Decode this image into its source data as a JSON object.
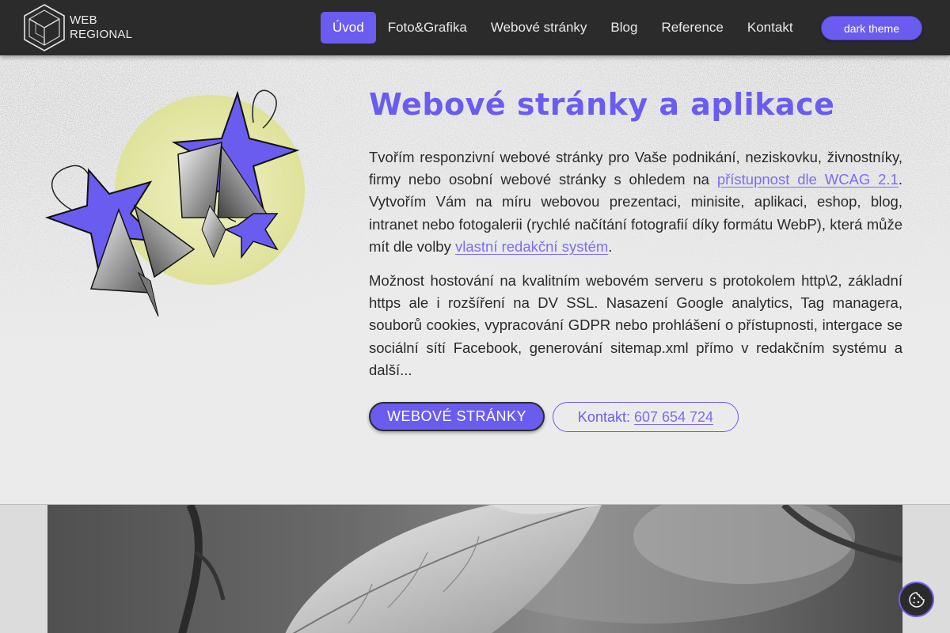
{
  "header": {
    "logo": {
      "line1": "WEB",
      "line2": "REGIONAL"
    },
    "nav": [
      {
        "label": "Úvod",
        "active": true
      },
      {
        "label": "Foto&Grafika"
      },
      {
        "label": "Webové stránky"
      },
      {
        "label": "Blog"
      },
      {
        "label": "Reference"
      },
      {
        "label": "Kontakt"
      }
    ],
    "theme_button": "dark theme"
  },
  "hero": {
    "title": "Webové stránky a aplikace",
    "p1": {
      "text_a": "Tvořím responzivní webové stránky pro Vaše podnikání, neziskovku, živnostníky, firmy nebo osobní webové stránky s ohledem na ",
      "link_a": "přístupnost dle WCAG 2.1",
      "text_b": ". Vytvořím Vám na míru webovou prezentaci, minisite, aplikaci, eshop, blog, intranet nebo fotogalerii (rychlé načítání fotografií díky formátu WebP), která může mít dle volby ",
      "link_b": "vlastní redakční systém",
      "text_c": "."
    },
    "p2": "Možnost hostování na kvalitním webovém serveru s protokolem http\\2, základní https ale i rozšíření na DV SSL. Nasazení Google analytics, Tag managera, souborů cookies, vypracování GDPR nebo prohlášení o přístupnosti, intergace se sociální sítí Facebook, generování sitemap.xml přímo v redakčním systému a další...",
    "cta_primary": "WEBOVÉ STRÁNKY",
    "cta_secondary_label": "Kontakt:",
    "cta_secondary_phone": "607 654 724"
  },
  "icons": {
    "logo": "cube-logo-icon",
    "art": "stars-moon-illustration",
    "cookie": "cookie-icon"
  },
  "colors": {
    "accent": "#6b5cf0",
    "header_bg": "#2b2b2b",
    "page_bg": "#ebebeb",
    "moon": "#e4e6a6"
  }
}
